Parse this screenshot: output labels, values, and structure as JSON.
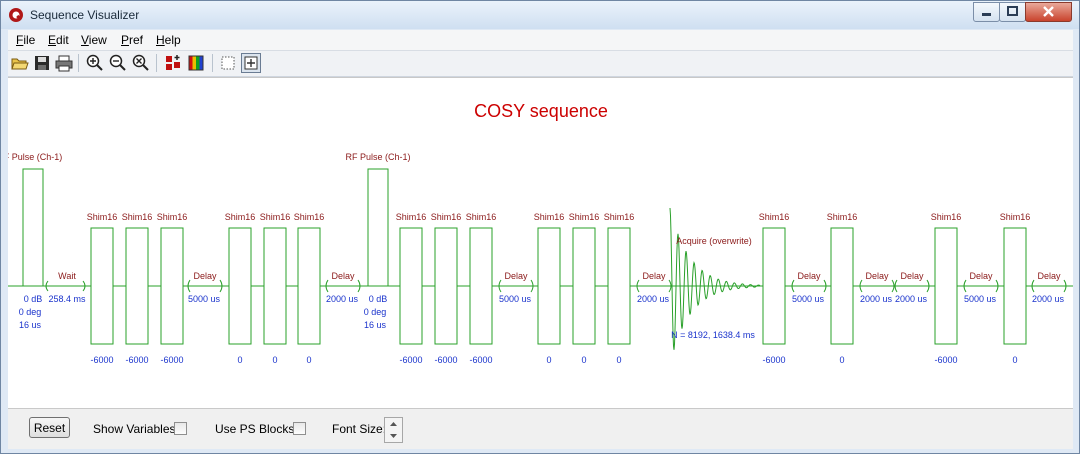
{
  "window": {
    "title": "Sequence Visualizer"
  },
  "menu": [
    {
      "label": "File"
    },
    {
      "label": "Edit"
    },
    {
      "label": "View"
    },
    {
      "label": "Pref"
    },
    {
      "label": "Help"
    }
  ],
  "toolbar": {
    "buttons": [
      "open-icon",
      "save-icon",
      "print-icon",
      "zoom-in-icon",
      "zoom-out-icon",
      "zoom-reset-icon",
      "channels-icon",
      "color-palette-icon",
      "grid-icon",
      "fit-icon"
    ]
  },
  "diagram": {
    "title": "COSY sequence",
    "pulse_label": "RF Pulse (Ch-1)",
    "pulse_label_clipped": "F Pulse (Ch-1)",
    "shim_label": "Shim16",
    "delay_label": "Delay",
    "wait_label": "Wait",
    "wait_value": "258.4 ms",
    "pulse_power": "0 dB",
    "pulse_phase": "0 deg",
    "pulse_length": "16 us",
    "acquire_label": "Acquire (overwrite)",
    "acquire_value": "N = 8192, 1638.4 ms",
    "colors": {
      "title": "#cc0000",
      "waveform": "#2aa02a",
      "label": "#8b1a1a",
      "value": "#1a33cc"
    },
    "shim_groups": [
      {
        "values": [
          "-6000",
          "-6000",
          "-6000"
        ]
      },
      {
        "values": [
          "0",
          "0",
          "0"
        ]
      },
      {
        "values": [
          "-6000",
          "-6000",
          "-6000"
        ]
      },
      {
        "values": [
          "0",
          "0",
          "0"
        ]
      },
      {
        "values": [
          "-6000"
        ]
      },
      {
        "values": [
          "0"
        ]
      },
      {
        "values": [
          "-6000"
        ]
      },
      {
        "values": [
          "0"
        ]
      }
    ],
    "delays": [
      "5000 us",
      "2000 us",
      "5000 us",
      "2000 us",
      "5000 us",
      "2000 us",
      "2000 us",
      "5000 us",
      "2000 us"
    ]
  },
  "statusbar": {
    "reset_label": "Reset",
    "show_variables_label": "Show Variables:",
    "show_variables_checked": false,
    "use_ps_blocks_label": "Use PS Blocks:",
    "use_ps_blocks_checked": false,
    "font_size_label": "Font Size:"
  }
}
